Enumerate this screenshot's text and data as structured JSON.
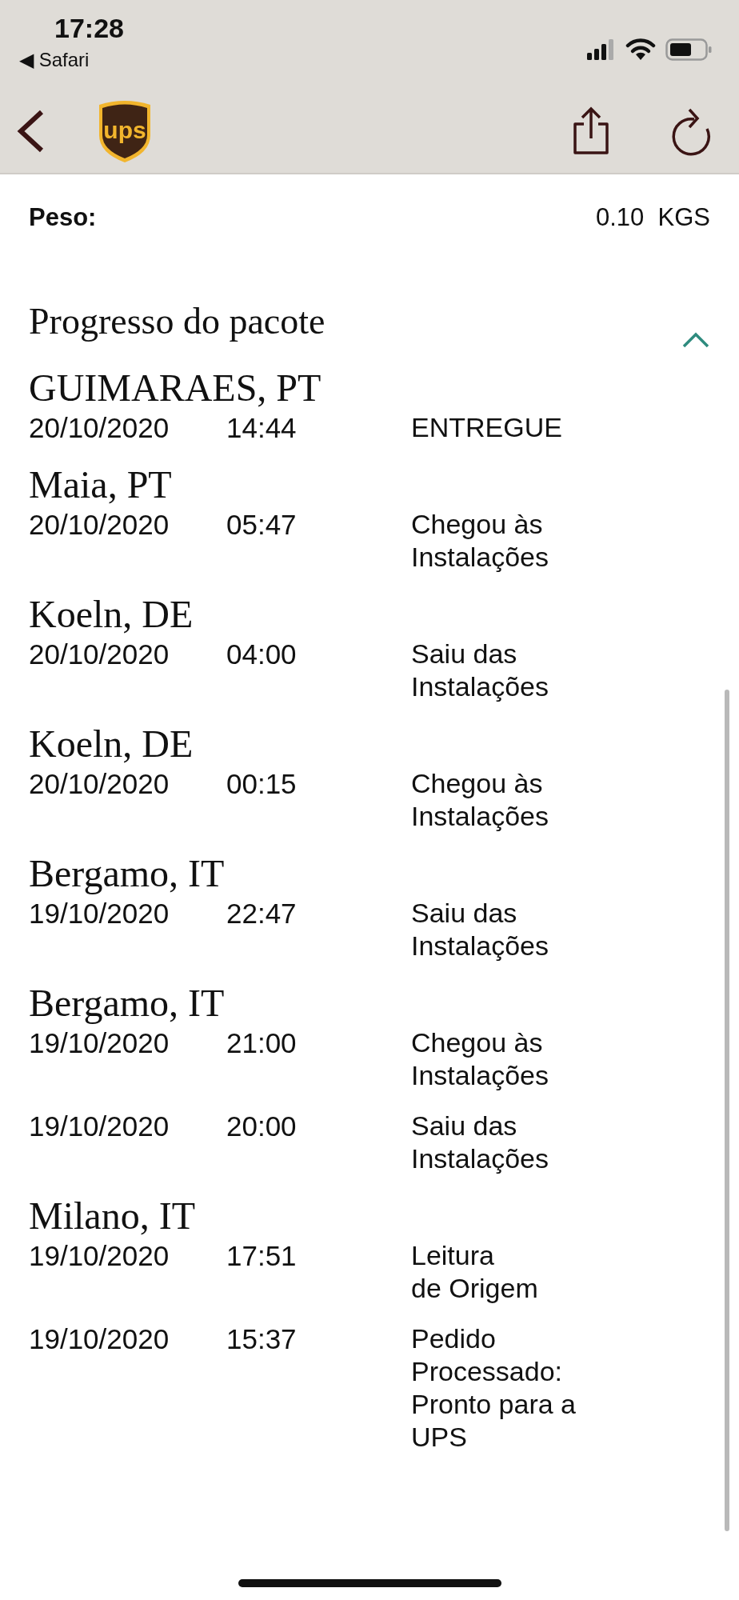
{
  "status_bar": {
    "time": "17:28",
    "back_app": "◀ Safari"
  },
  "nav": {
    "logo_text": "ups"
  },
  "weight": {
    "label": "Peso:",
    "value": "0.10  KGS"
  },
  "progress": {
    "title": "Progresso do pacote",
    "expanded": true,
    "events": [
      {
        "location": "GUIMARAES, PT",
        "date": "20/10/2020",
        "time": "14:44",
        "status": [
          "ENTREGUE"
        ]
      },
      {
        "location": "Maia, PT",
        "date": "20/10/2020",
        "time": "05:47",
        "status": [
          "Chegou às",
          "Instalações"
        ]
      },
      {
        "location": "Koeln, DE",
        "date": "20/10/2020",
        "time": "04:00",
        "status": [
          "Saiu das",
          "Instalações"
        ]
      },
      {
        "location": "Koeln, DE",
        "date": "20/10/2020",
        "time": "00:15",
        "status": [
          "Chegou às",
          "Instalações"
        ]
      },
      {
        "location": "Bergamo, IT",
        "date": "19/10/2020",
        "time": "22:47",
        "status": [
          "Saiu das",
          "Instalações"
        ]
      },
      {
        "location": "Bergamo, IT",
        "date": "19/10/2020",
        "time": "21:00",
        "status": [
          "Chegou às",
          "Instalações"
        ]
      },
      {
        "date": "19/10/2020",
        "time": "20:00",
        "status": [
          "Saiu das",
          "Instalações"
        ]
      },
      {
        "location": "Milano, IT",
        "date": "19/10/2020",
        "time": "17:51",
        "status": [
          "Leitura",
          "de Origem"
        ]
      },
      {
        "date": "19/10/2020",
        "time": "15:37",
        "status": [
          "Pedido",
          "Processado:",
          "Pronto para a",
          "UPS"
        ]
      }
    ]
  }
}
